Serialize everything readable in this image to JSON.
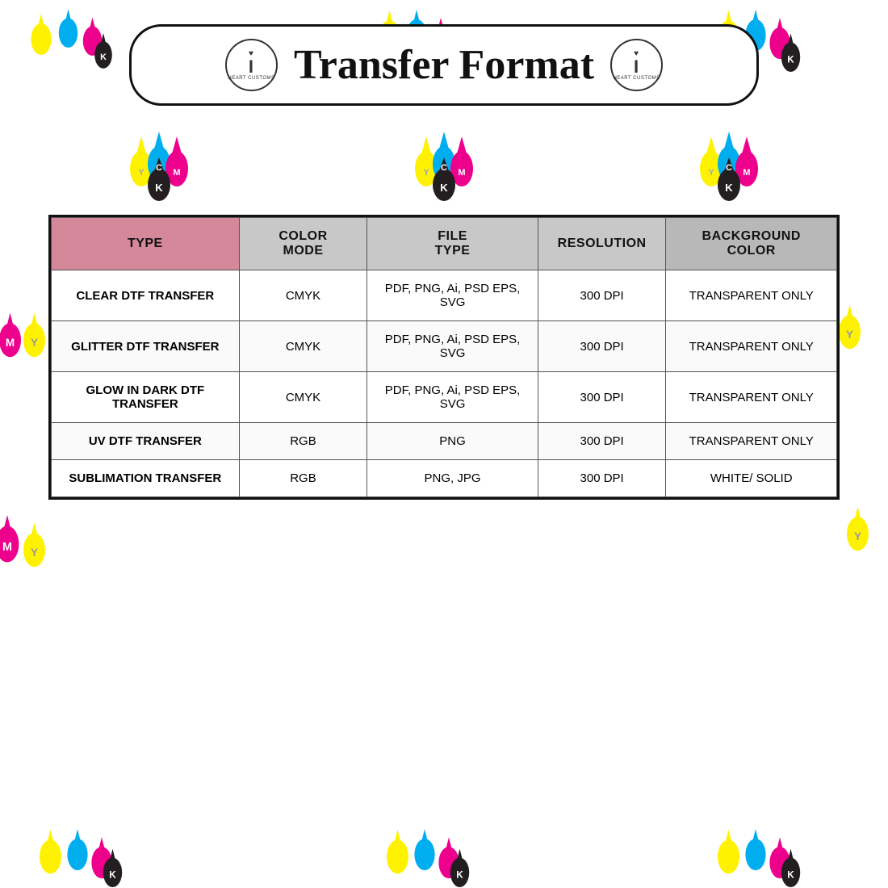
{
  "title": "Transfer Format",
  "logo": {
    "letter": "i",
    "subtext": "HEART CUSTOMS",
    "heart": "♥"
  },
  "table": {
    "headers": [
      "TYPE",
      "COLOR MODE",
      "FILE TYPE",
      "RESOLUTION",
      "BACKGROUND COLOR"
    ],
    "rows": [
      {
        "type": "CLEAR DTF TRANSFER",
        "colorMode": "CMYK",
        "fileType": "PDF, PNG, Ai, PSD EPS, SVG",
        "resolution": "300 DPI",
        "bgColor": "TRANSPARENT ONLY"
      },
      {
        "type": "GLITTER DTF TRANSFER",
        "colorMode": "CMYK",
        "fileType": "PDF, PNG, Ai, PSD EPS, SVG",
        "resolution": "300 DPI",
        "bgColor": "TRANSPARENT ONLY"
      },
      {
        "type": "GLOW IN DARK DTF TRANSFER",
        "colorMode": "CMYK",
        "fileType": "PDF, PNG, Ai, PSD EPS, SVG",
        "resolution": "300 DPI",
        "bgColor": "TRANSPARENT ONLY"
      },
      {
        "type": "UV DTF TRANSFER",
        "colorMode": "RGB",
        "fileType": "PNG",
        "resolution": "300 DPI",
        "bgColor": "TRANSPARENT ONLY"
      },
      {
        "type": "SUBLIMATION TRANSFER",
        "colorMode": "RGB",
        "fileType": "PNG, JPG",
        "resolution": "300 DPI",
        "bgColor": "WHITE/ SOLID"
      }
    ]
  },
  "colors": {
    "cyan": "#00AEEF",
    "magenta": "#EC008C",
    "yellow": "#FFF200",
    "black": "#231F20",
    "pink_header": "#d4889a",
    "gray_header": "#c8c8c8"
  }
}
